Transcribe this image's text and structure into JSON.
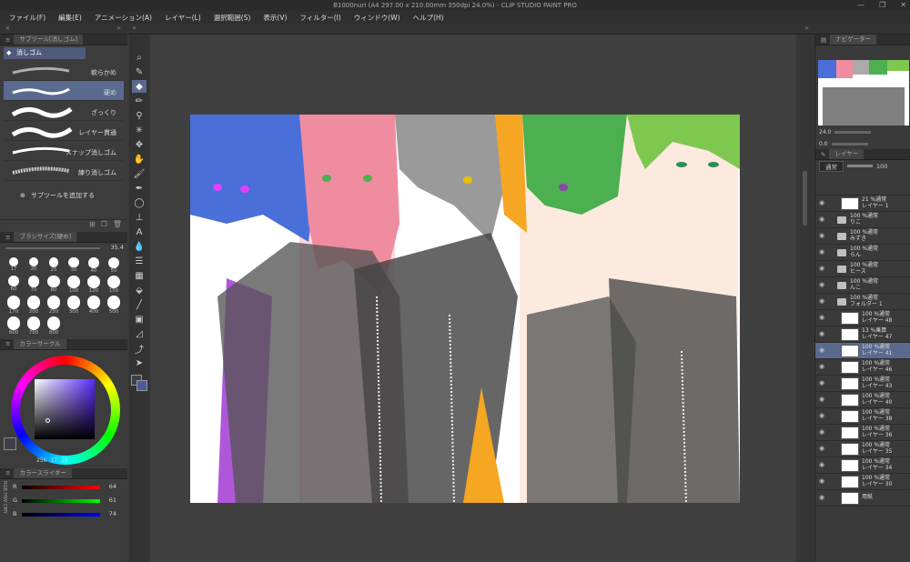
{
  "app": {
    "title": "B1000nuri (A4 297.00 x 210.00mm 350dpi 24.0%) - CLIP STUDIO PAINT PRO"
  },
  "menu": [
    "ファイル(F)",
    "編集(E)",
    "アニメーション(A)",
    "レイヤー(L)",
    "選択範囲(S)",
    "表示(V)",
    "フィルター(I)",
    "ウィンドウ(W)",
    "ヘルプ(H)"
  ],
  "subtool": {
    "panel_title": "サブツール[消しゴム]",
    "group": "消しゴム",
    "items": [
      {
        "label": "軟らかめ"
      },
      {
        "label": "硬め"
      },
      {
        "label": "ざっくり"
      },
      {
        "label": "レイヤー貫通"
      },
      {
        "label": "スナップ消しゴム"
      },
      {
        "label": "練り消しゴム"
      }
    ],
    "add_label": "サブツールを追加する"
  },
  "brushsize": {
    "panel_title": "ブラシサイズ[硬め]",
    "current": "35.4",
    "sizes": [
      "17",
      "20",
      "25",
      "30",
      "40",
      "50",
      "60",
      "70",
      "80",
      "100",
      "120",
      "150",
      "170",
      "200",
      "250",
      "300",
      "400",
      "500",
      "600",
      "700",
      "800"
    ]
  },
  "colorcircle": {
    "panel_title": "カラーサークル",
    "h": "256",
    "s": "17",
    "v": "29"
  },
  "colorslider": {
    "panel_title": "カラースライダー",
    "mode_tabs": [
      "RGB",
      "HSV",
      "CMY"
    ],
    "r": {
      "label": "R",
      "value": "64"
    },
    "g": {
      "label": "G",
      "value": "61"
    },
    "b": {
      "label": "B",
      "value": "74"
    }
  },
  "navigator": {
    "title": "ナビゲーター",
    "zoom": "24.0",
    "angle": "0.0"
  },
  "layers": {
    "panel_title": "レイヤー",
    "blend": "通常",
    "opacity": "100",
    "rows": [
      {
        "top": "21 %通常",
        "bottom": "レイヤー 1",
        "kind": "layer"
      },
      {
        "top": "100 %通常",
        "bottom": "りこ",
        "kind": "folder"
      },
      {
        "top": "100 %通常",
        "bottom": "みずき",
        "kind": "folder"
      },
      {
        "top": "100 %通常",
        "bottom": "らん",
        "kind": "folder"
      },
      {
        "top": "100 %通常",
        "bottom": "ヒース",
        "kind": "folder"
      },
      {
        "top": "100 %通常",
        "bottom": "んこ",
        "kind": "folder"
      },
      {
        "top": "100 %通常",
        "bottom": "フォルダー 1",
        "kind": "folder"
      },
      {
        "top": "100 %通常",
        "bottom": "レイヤー 48",
        "kind": "layer"
      },
      {
        "top": "13 %乗算",
        "bottom": "レイヤー 47",
        "kind": "layer"
      },
      {
        "top": "100 %通常",
        "bottom": "レイヤー 41",
        "kind": "layer",
        "selected": true
      },
      {
        "top": "100 %通常",
        "bottom": "レイヤー 46",
        "kind": "layer"
      },
      {
        "top": "100 %通常",
        "bottom": "レイヤー 43",
        "kind": "layer"
      },
      {
        "top": "100 %通常",
        "bottom": "レイヤー 40",
        "kind": "layer"
      },
      {
        "top": "100 %通常",
        "bottom": "レイヤー 38",
        "kind": "layer"
      },
      {
        "top": "100 %通常",
        "bottom": "レイヤー 36",
        "kind": "layer"
      },
      {
        "top": "100 %通常",
        "bottom": "レイヤー 35",
        "kind": "layer"
      },
      {
        "top": "100 %通常",
        "bottom": "レイヤー 34",
        "kind": "layer"
      },
      {
        "top": "100 %通常",
        "bottom": "レイヤー 30",
        "kind": "layer"
      },
      {
        "top": "",
        "bottom": "用紙",
        "kind": "paper"
      }
    ]
  },
  "colors": {
    "accent": "#5a6a8f",
    "blue_hair": "#4a6fd8",
    "pink_hair": "#f08ca0",
    "gray_hair": "#a0a0a0",
    "orange_hair": "#f5a623",
    "green_hair": "#4caf50",
    "lime_hair": "#7ec850",
    "purple": "#b057d9"
  }
}
